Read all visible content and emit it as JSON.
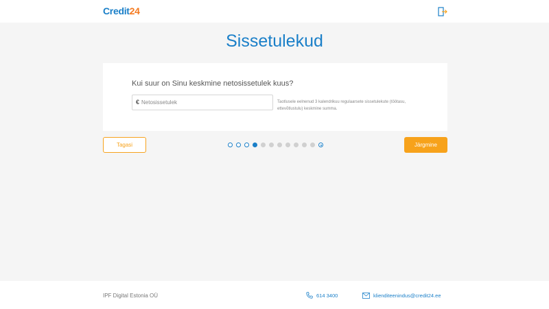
{
  "header": {
    "logo_part1": "Credit",
    "logo_part2": "24",
    "logout_icon": "logout-icon"
  },
  "page": {
    "title": "Sissetulekud"
  },
  "form": {
    "question": "Kui suur on Sinu keskmine netosissetulek kuus?",
    "currency_symbol": "€",
    "income_value": "",
    "income_placeholder": "Netosissetulek",
    "hint": "Taotlusele eelnenud 3 kalendrikuu regulaarsete sissetulekute (töötasu, ettevõtlustulu) keskmine summa."
  },
  "navigation": {
    "back_label": "Tagasi",
    "next_label": "Järgmine"
  },
  "progress": {
    "total_steps": 12,
    "current_step": 4
  },
  "footer": {
    "company": "IPF Digital Estonia OÜ",
    "phone": "614 3400",
    "email": "klienditeenindus@credit24.ee"
  },
  "colors": {
    "brand_blue": "#1a7fc8",
    "brand_orange": "#f7a21b",
    "logo_orange": "#f47a20"
  }
}
